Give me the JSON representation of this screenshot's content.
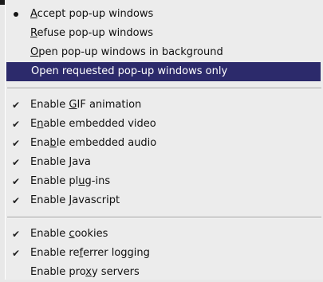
{
  "menu": {
    "popup_group": [
      {
        "mark": "bullet",
        "pre": "",
        "key": "A",
        "post": "ccept pop-up windows"
      },
      {
        "mark": "",
        "pre": "",
        "key": "R",
        "post": "efuse pop-up windows"
      },
      {
        "mark": "",
        "pre": "",
        "key": "O",
        "post": "pen pop-up windows in background"
      },
      {
        "mark": "",
        "pre": "Open requested pop-up windows only",
        "key": "",
        "post": ""
      }
    ],
    "features_group": [
      {
        "mark": "check",
        "pre": "Enable ",
        "key": "G",
        "post": "IF animation"
      },
      {
        "mark": "check",
        "pre": "E",
        "key": "n",
        "post": "able embedded video"
      },
      {
        "mark": "check",
        "pre": "Ena",
        "key": "b",
        "post": "le embedded audio"
      },
      {
        "mark": "check",
        "pre": "Enable ",
        "key": "J",
        "post": "ava"
      },
      {
        "mark": "check",
        "pre": "Enable pl",
        "key": "u",
        "post": "g-ins"
      },
      {
        "mark": "check",
        "pre": "Enable ",
        "key": "J",
        "post": "avascript"
      }
    ],
    "network_group": [
      {
        "mark": "check",
        "pre": "Enable ",
        "key": "c",
        "post": "ookies"
      },
      {
        "mark": "check",
        "pre": "Enable re",
        "key": "f",
        "post": "errer logging"
      },
      {
        "mark": "",
        "pre": "Enable pro",
        "key": "x",
        "post": "y servers"
      }
    ],
    "selected_index_popup_group": 3,
    "colors": {
      "highlight": "#2c2a6b",
      "menu_bg": "#ececec"
    }
  }
}
